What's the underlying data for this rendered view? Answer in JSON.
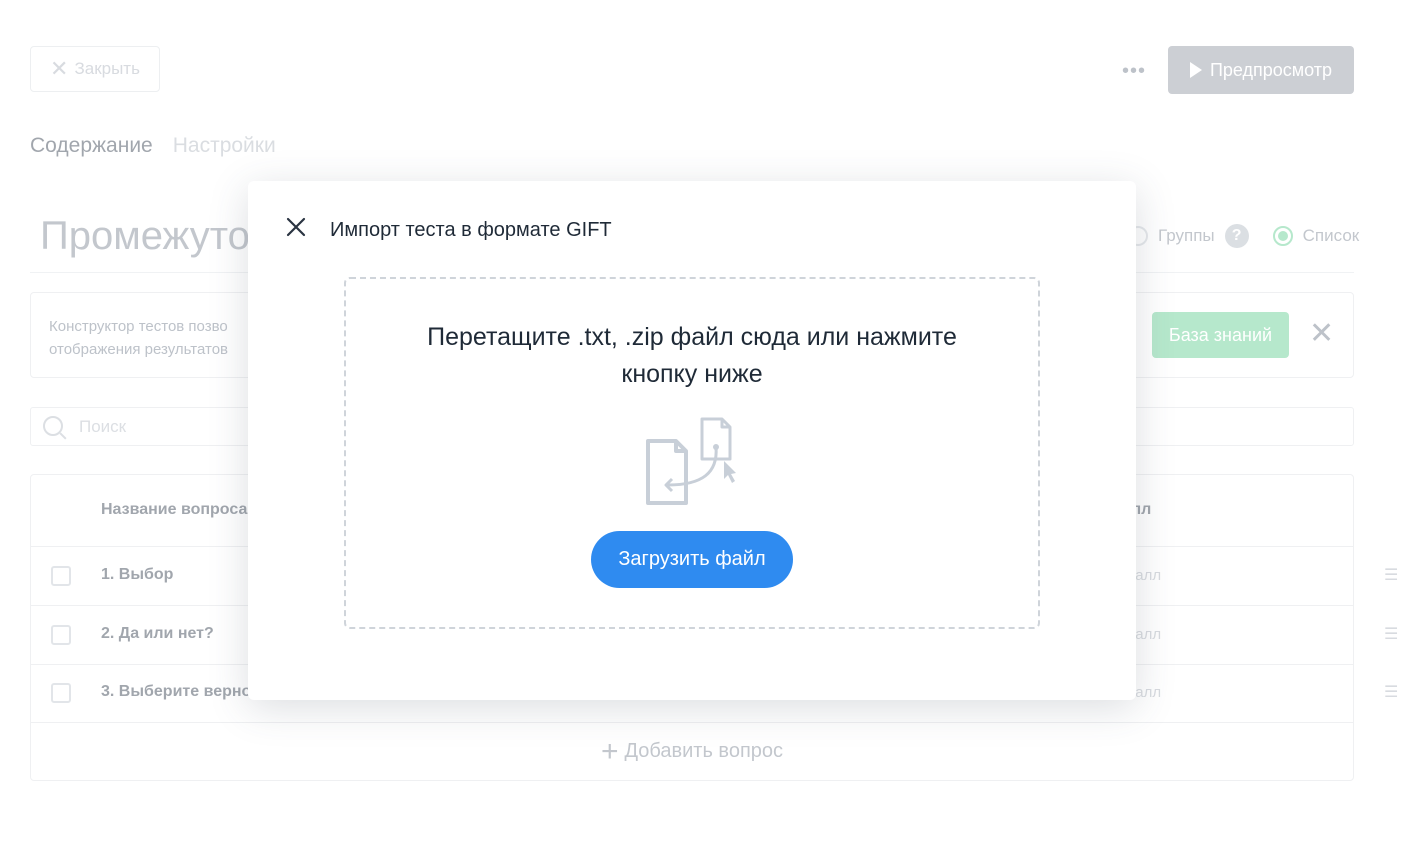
{
  "topbar": {
    "close_label": "Закрыть",
    "more_label": "•••",
    "preview_label": "Предпросмотр"
  },
  "tabs": [
    {
      "label": "Содержание",
      "active": true
    },
    {
      "label": "Настройки",
      "active": false
    }
  ],
  "page_title": "Промежуто",
  "view": {
    "groups_label": "Группы",
    "list_label": "Список",
    "selected": "Список"
  },
  "info": {
    "line1": "Конструктор тестов позво",
    "line2": "отображения результатов",
    "kb_button": "База знаний"
  },
  "search": {
    "placeholder": "Поиск"
  },
  "table": {
    "col_name": "Название вопроса",
    "col_score": "лл",
    "rows": [
      {
        "name": "1. Выбор",
        "score": "балл"
      },
      {
        "name": "2. Да или нет?",
        "score": "балл"
      },
      {
        "name": "3. Выберите верно",
        "score": "балл"
      }
    ],
    "add_label": "Добавить вопрос"
  },
  "modal": {
    "title": "Импорт теста в формате GIFT",
    "drop_text": "Перетащите .txt, .zip файл сюда или нажмите кнопку ниже",
    "upload_label": "Загрузить файл"
  },
  "colors": {
    "primary": "#2f8bf0",
    "success": "#8fdcb1",
    "preview_bg": "#b1b6bd"
  }
}
